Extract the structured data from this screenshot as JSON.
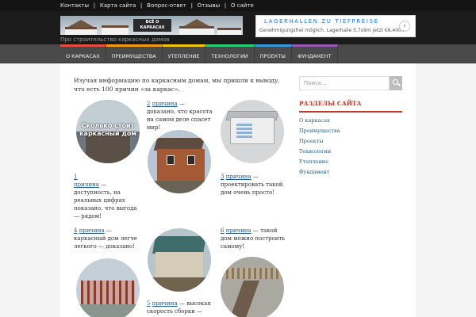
{
  "topnav": {
    "items": [
      "Контакты",
      "Карта сайта",
      "Вопрос-ответ",
      "Отзывы",
      "О сайте"
    ]
  },
  "header": {
    "logo_text": "ВСЁ О КАРКАСАХ",
    "tagline": "Про строительство каркасных домов"
  },
  "ad": {
    "title": "LAGERHALLEN ZU TIEFPREISE",
    "text": "Genehmigungsfrei möglich. Lagerhalle 5,7x9m jetzt €6.400,-",
    "arrow_icon": "chevron-right-icon"
  },
  "mainnav": {
    "items": [
      "О каркасах",
      "Преимущества",
      "Утепление",
      "Технологии",
      "Проекты",
      "Фундамент"
    ]
  },
  "intro": "Изучая информацию по каркасным домам, мы пришли к выводу, что есть 100 причин «за каркас».",
  "reasons": [
    {
      "num": "1",
      "link": "причина",
      "text": " — доступность, на реальных цифрах показано, что выгода — рядом!"
    },
    {
      "num": "2",
      "link": "причина",
      "text": " — доказано, что красота на самом деле спасет мир!"
    },
    {
      "num": "3",
      "link": "причина",
      "text": " — проектировать такой дом очень просто!"
    },
    {
      "num": "4",
      "link": "причина",
      "text": " — каркасный дом легче легкого — доказано!"
    },
    {
      "num": "5",
      "link": "причина",
      "text": " — высокая скорость сборки —"
    },
    {
      "num": "6",
      "link": "причина",
      "text": " — такой дом можно построить самому!"
    }
  ],
  "circle1_text": "Сколько стоит каркасный дом",
  "sidebar": {
    "search_placeholder": "Поиск...",
    "title": "Разделы сайта",
    "items": [
      "О каркасах",
      "Преимущества",
      "Проекты",
      "Технологии",
      "Утепление",
      "Фундамент"
    ]
  },
  "colors": {
    "accent": "#c0392b",
    "link": "#1e5c8c",
    "nav": "#4a4a4a"
  }
}
